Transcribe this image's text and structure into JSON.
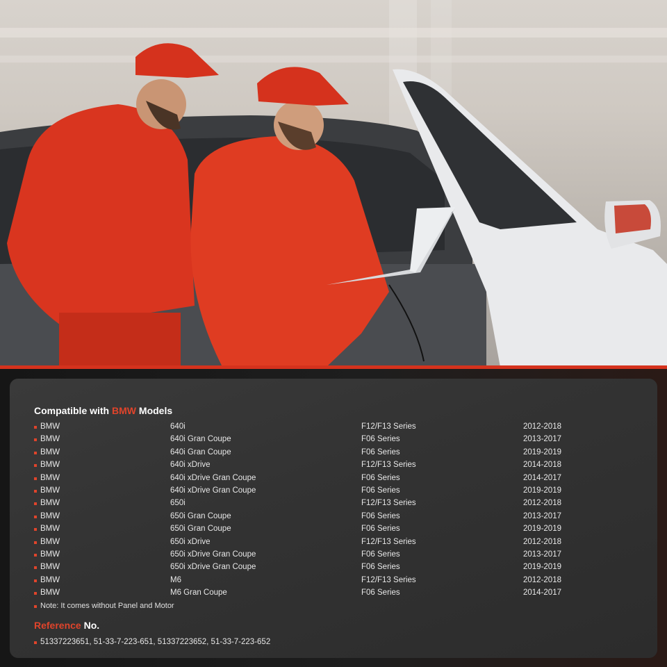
{
  "compat": {
    "title_prefix": "Compatible with",
    "brand": "BMW",
    "title_suffix": "Models",
    "rows": [
      [
        "BMW",
        "640i",
        "F12/F13 Series",
        "2012-2018"
      ],
      [
        "BMW",
        "640i Gran Coupe",
        "F06 Series",
        "2013-2017"
      ],
      [
        "BMW",
        "640i Gran Coupe",
        "F06 Series",
        "2019-2019"
      ],
      [
        "BMW",
        "640i xDrive",
        "F12/F13 Series",
        "2014-2018"
      ],
      [
        "BMW",
        "640i xDrive Gran Coupe",
        "F06 Series",
        "2014-2017"
      ],
      [
        "BMW",
        "640i xDrive Gran Coupe",
        "F06 Series",
        "2019-2019"
      ],
      [
        "BMW",
        "650i",
        "F12/F13 Series",
        "2012-2018"
      ],
      [
        "BMW",
        "650i Gran Coupe",
        "F06 Series",
        "2013-2017"
      ],
      [
        "BMW",
        "650i Gran Coupe",
        "F06 Series",
        "2019-2019"
      ],
      [
        "BMW",
        "650i xDrive",
        "F12/F13 Series",
        "2012-2018"
      ],
      [
        "BMW",
        "650i xDrive Gran Coupe",
        "F06 Series",
        "2013-2017"
      ],
      [
        "BMW",
        "650i xDrive Gran Coupe",
        "F06 Series",
        "2019-2019"
      ],
      [
        "BMW",
        "M6",
        "F12/F13 Series",
        "2012-2018"
      ],
      [
        "BMW",
        "M6 Gran Coupe",
        "F06 Series",
        "2014-2017"
      ]
    ],
    "note": "Note: It comes without Panel and Motor"
  },
  "reference": {
    "title_highlight": "Reference",
    "title_rest": "No.",
    "numbers": "51337223651, 51-33-7-223-651, 51337223652, 51-33-7-223-652"
  },
  "colors": {
    "accent": "#e0442b",
    "panel": "#333333",
    "uniform": "#d9351f"
  }
}
